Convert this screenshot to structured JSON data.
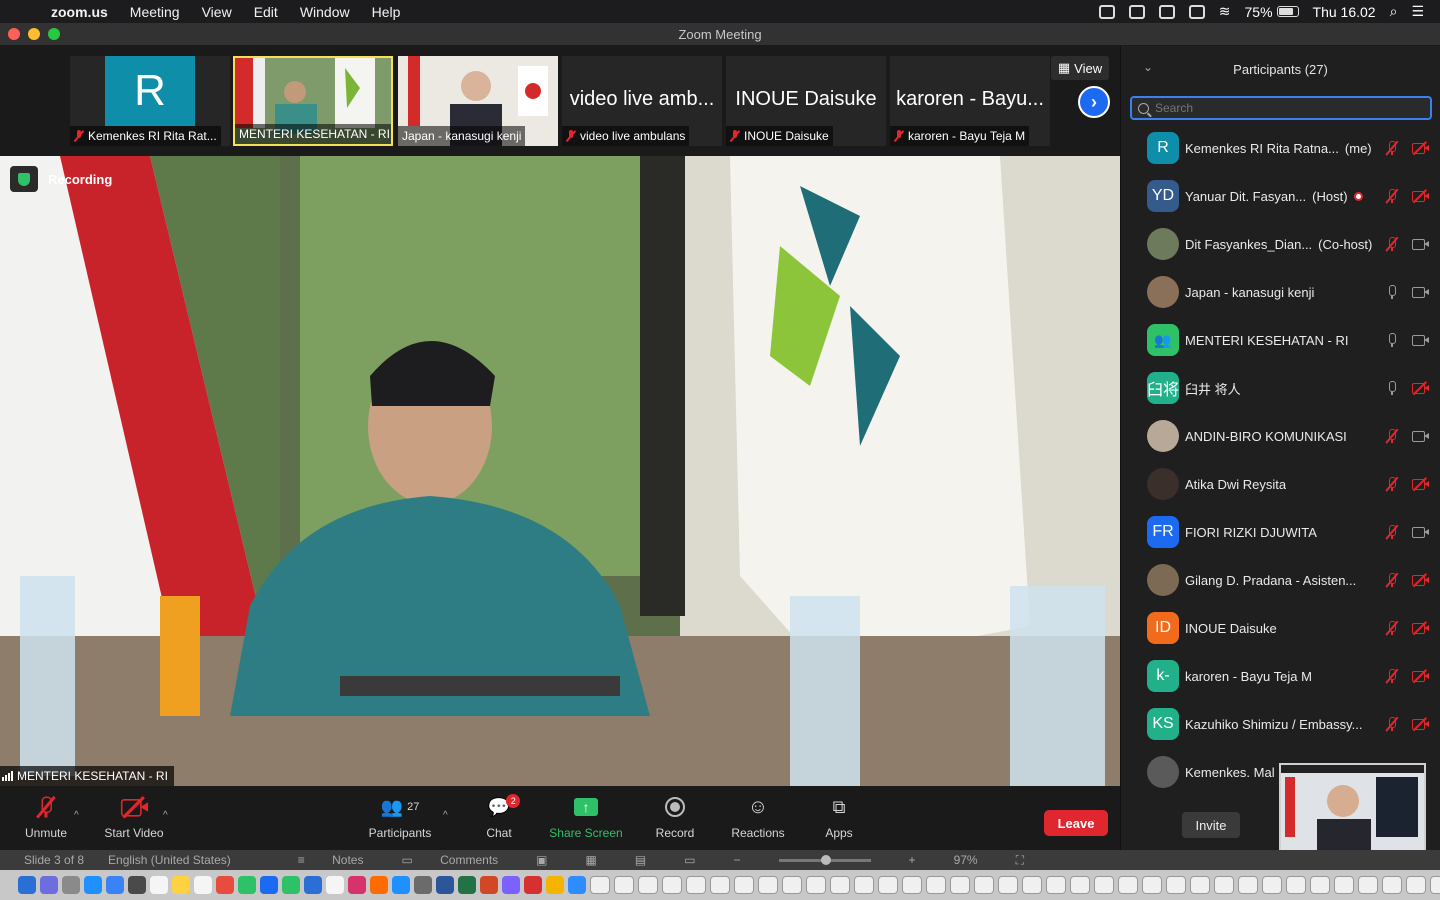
{
  "menubar": {
    "app_name": "zoom.us",
    "items": [
      "Meeting",
      "View",
      "Edit",
      "Window",
      "Help"
    ],
    "battery": "75%",
    "clock": "Thu 16.02"
  },
  "window": {
    "title": "Zoom Meeting"
  },
  "thumbnails": [
    {
      "name": "Kemenkes RI Rita Rat...",
      "initial": "R",
      "muted": true
    },
    {
      "name": "MENTERI KESEHATAN - RI",
      "muted": false,
      "active": true
    },
    {
      "name": "Japan - kanasugi kenji",
      "muted": false
    },
    {
      "name": "video live ambulans",
      "big": "video live amb...",
      "muted": true
    },
    {
      "name": "INOUE Daisuke",
      "big": "INOUE Daisuke",
      "muted": true
    },
    {
      "name": "karoren - Bayu Teja M",
      "big": "karoren - Bayu...",
      "muted": true
    }
  ],
  "strip": {
    "view_label": "View"
  },
  "main_video": {
    "recording_label": "Recording",
    "speaker_name": "MENTERI KESEHATAN - RI"
  },
  "participants": {
    "title": "Participants (27)",
    "search_placeholder": "Search",
    "invite_label": "Invite",
    "list": [
      {
        "initials": "R",
        "color": "#0e8ea8",
        "name": "Kemenkes RI Rita Ratna...",
        "role": "(me)",
        "mic": "off",
        "cam": "off"
      },
      {
        "initials": "YD",
        "color": "#355a8c",
        "name": "Yanuar Dit. Fasyan...",
        "role": "(Host)",
        "recording": true,
        "mic": "off",
        "cam": "off"
      },
      {
        "initials": "",
        "color": "#6d7a5c",
        "name": "Dit Fasyankes_Dian...",
        "role": "(Co-host)",
        "photo": true,
        "mic": "off",
        "cam": "on"
      },
      {
        "initials": "",
        "color": "#8a7058",
        "name": "Japan - kanasugi kenji",
        "photo": true,
        "mic": "on",
        "cam": "on"
      },
      {
        "initials": "",
        "color": "#2fc167",
        "name": "MENTERI KESEHATAN - RI",
        "icon": "people",
        "mic": "on",
        "cam": "on"
      },
      {
        "initials": "臼将",
        "color": "#22b08a",
        "name": "臼井 将人",
        "mic": "on",
        "cam": "off"
      },
      {
        "initials": "",
        "color": "#b8a898",
        "name": "ANDIN-BIRO KOMUNIKASI",
        "photo": true,
        "mic": "off",
        "cam": "on"
      },
      {
        "initials": "",
        "color": "#3a2f2a",
        "name": "Atika Dwi Reysita",
        "photo": true,
        "mic": "off",
        "cam": "off"
      },
      {
        "initials": "FR",
        "color": "#1d6af2",
        "name": "FIORI RIZKI DJUWITA",
        "mic": "off",
        "cam": "on"
      },
      {
        "initials": "",
        "color": "#7d6a55",
        "name": "Gilang D. Pradana - Asisten...",
        "photo": true,
        "mic": "off",
        "cam": "off"
      },
      {
        "initials": "ID",
        "color": "#f26a1b",
        "name": "INOUE Daisuke",
        "mic": "off",
        "cam": "off"
      },
      {
        "initials": "k-",
        "color": "#22b08a",
        "name": "karoren - Bayu Teja M",
        "mic": "off",
        "cam": "off"
      },
      {
        "initials": "KS",
        "color": "#22b08a",
        "name": "Kazuhiko Shimizu / Embassy...",
        "mic": "off",
        "cam": "off"
      },
      {
        "initials": "",
        "color": "#5a5a5a",
        "name": "Kemenkes. Mal",
        "photo": true,
        "mic": "",
        "cam": ""
      }
    ]
  },
  "toolbar": {
    "unmute": "Unmute",
    "start_video": "Start Video",
    "participants_count": "27",
    "participants": "Participants",
    "chat": "Chat",
    "chat_badge": "2",
    "share_screen": "Share Screen",
    "record": "Record",
    "reactions": "Reactions",
    "apps": "Apps",
    "leave": "Leave"
  },
  "statusbar": {
    "slide": "Slide 3 of 8",
    "language": "English (United States)",
    "notes": "Notes",
    "comments": "Comments",
    "zoom": "97%"
  },
  "colors": {
    "accent_blue": "#1d6af2",
    "leave_red": "#e0262e",
    "share_green": "#2fc167",
    "active_border": "#f4e05a"
  }
}
